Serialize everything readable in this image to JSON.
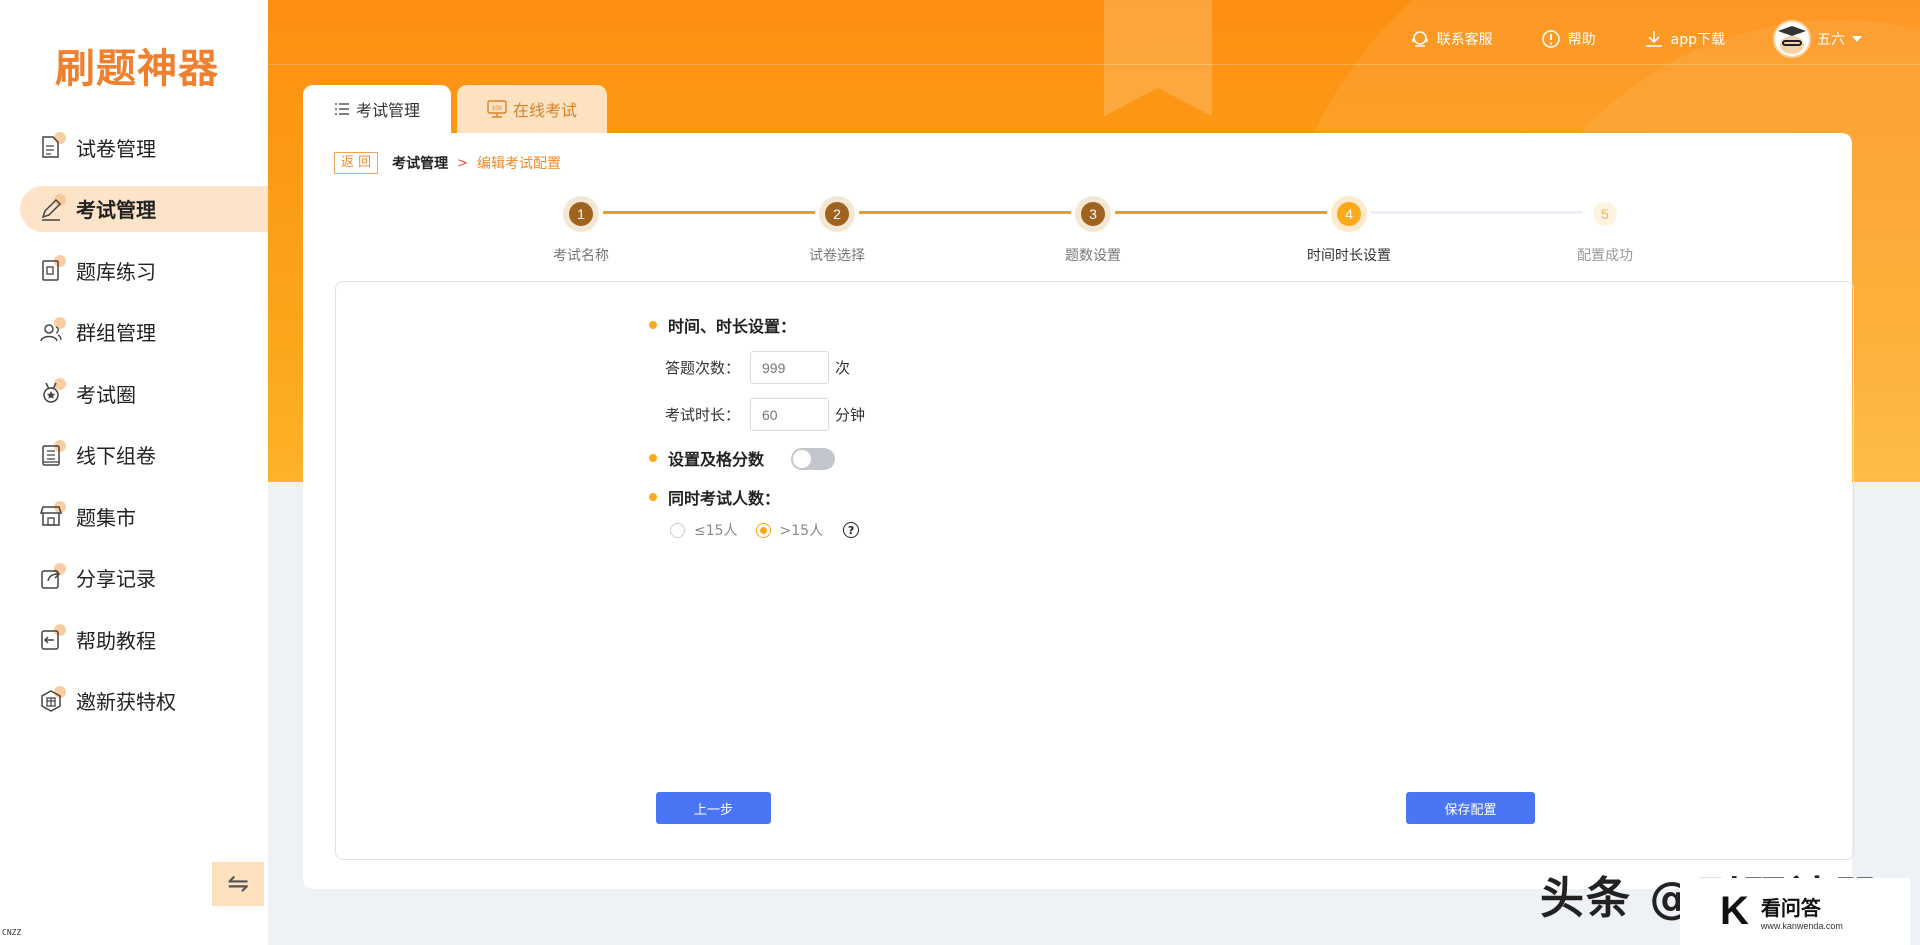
{
  "logo": "刷题神器",
  "sidebar": {
    "items": [
      {
        "label": "试卷管理",
        "icon": "document-icon",
        "active": false
      },
      {
        "label": "考试管理",
        "icon": "pencil-icon",
        "active": true
      },
      {
        "label": "题库练习",
        "icon": "practice-icon",
        "active": false
      },
      {
        "label": "群组管理",
        "icon": "group-icon",
        "active": false
      },
      {
        "label": "考试圈",
        "icon": "medal-icon",
        "active": false
      },
      {
        "label": "线下组卷",
        "icon": "book-icon",
        "active": false
      },
      {
        "label": "题集市",
        "icon": "store-icon",
        "active": false
      },
      {
        "label": "分享记录",
        "icon": "share-icon",
        "active": false
      },
      {
        "label": "帮助教程",
        "icon": "help-tutorial-icon",
        "active": false
      },
      {
        "label": "邀新获特权",
        "icon": "gift-icon",
        "active": false
      }
    ],
    "collapse_icon": "⇋",
    "cnzz": "CNZZ"
  },
  "header": {
    "service": "联系客服",
    "help": "帮助",
    "app_download": "app下载",
    "username": "五六"
  },
  "tabs": {
    "exam_manage": "考试管理",
    "online_exam": "在线考试"
  },
  "breadcrumb": {
    "back": "返 回",
    "current": "考试管理",
    "sep": ">",
    "page": "编辑考试配置"
  },
  "steps": [
    {
      "num": "1",
      "label": "考试名称",
      "state": "done"
    },
    {
      "num": "2",
      "label": "试卷选择",
      "state": "done"
    },
    {
      "num": "3",
      "label": "题数设置",
      "state": "done"
    },
    {
      "num": "4",
      "label": "时间时长设置",
      "state": "current"
    },
    {
      "num": "5",
      "label": "配置成功",
      "state": "todo"
    }
  ],
  "form": {
    "time_section": "时间、时长设置：",
    "attempts_label": "答题次数：",
    "attempts_placeholder": "999",
    "attempts_unit": "次",
    "duration_label": "考试时长：",
    "duration_placeholder": "60",
    "duration_unit": "分钟",
    "pass_score": "设置及格分数",
    "pass_score_enabled": false,
    "concurrent_section": "同时考试人数：",
    "option_small": "≤15人",
    "option_large": ">15人",
    "selected_option": ">15人",
    "help_glyph": "?"
  },
  "buttons": {
    "prev": "上一步",
    "save": "保存配置"
  },
  "watermark": {
    "toutiao": "头条 @刷题神器",
    "kan_logo": "K",
    "kanwenda": "看问答",
    "kanwenda_url": "www.kanwenda.com"
  },
  "colors": {
    "brand_orange": "#fd8f12",
    "step_done": "#a0621f",
    "step_current": "#fcaa1c",
    "primary_button": "#4a76f5"
  }
}
